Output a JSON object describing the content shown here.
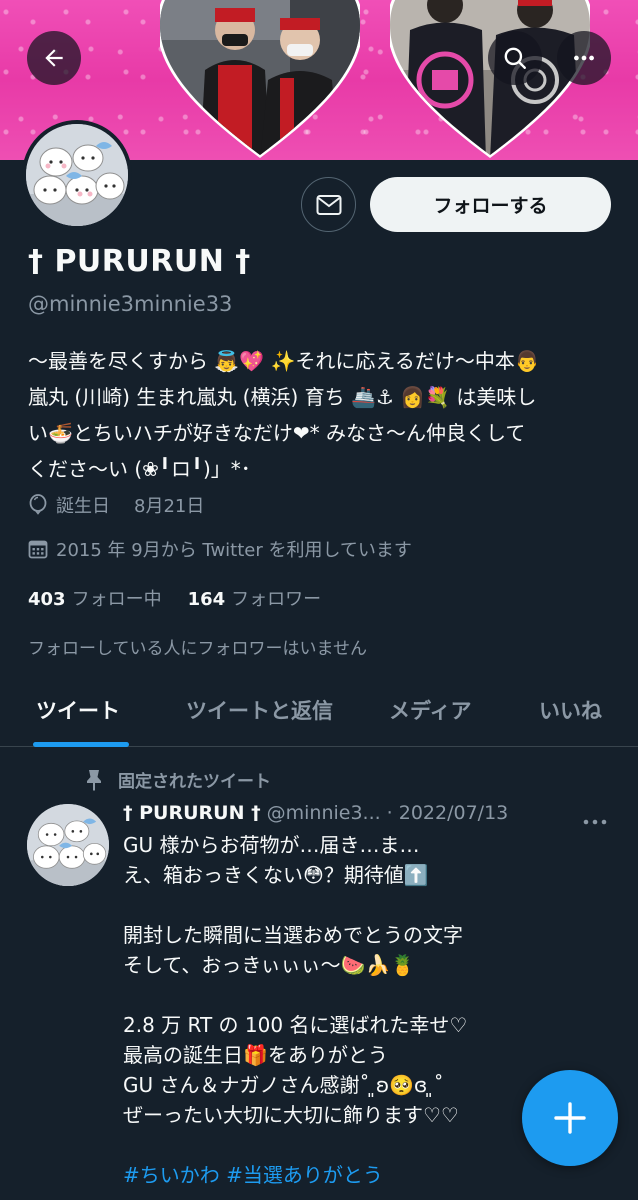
{
  "profile": {
    "display_name": "† PURURUN †",
    "handle": "@minnie3minnie33",
    "bio_lines": [
      "〜最善を尽くすから 👼💖 ✨それに応えるだけ〜中本👨",
      "嵐丸 (川崎) 生まれ嵐丸 (横浜) 育ち 🚢⚓ 👩💐 は美味し",
      "い🍜とちいハチが好きなだけ❤︎* みなさ〜ん仲良くして",
      "くださ〜い (❀╹ロ╹)」*･"
    ],
    "birthday_label": "誕生日",
    "birthday_value": "8月21日",
    "joined": "2015 年 9月から Twitter を利用しています",
    "following_count": "403",
    "following_label": "フォロー中",
    "followers_count": "164",
    "followers_label": "フォロワー",
    "no_mutuals_text": "フォローしている人にフォロワーはいません"
  },
  "actions": {
    "follow_label": "フォローする"
  },
  "tabs": [
    {
      "label": "ツイート",
      "active": true
    },
    {
      "label": "ツイートと返信",
      "active": false
    },
    {
      "label": "メディア",
      "active": false
    },
    {
      "label": "いいね",
      "active": false
    }
  ],
  "tweet": {
    "pinned_label": "固定されたツイート",
    "name": "† PURURUN †",
    "handle": "@minnie3...",
    "date": "· 2022/07/13",
    "lines": [
      "GU 様からお荷物が…届き…ま…",
      "え、箱おっきくない😳？期待値⬆️",
      "",
      "開封した瞬間に当選おめでとうの文字",
      "そして、おっきぃぃぃ〜🍉🍌🍍",
      "",
      "2.8 万 RT の 100 名に選ばれた幸せ♡",
      "最高の誕生日🎁をありがとう",
      "GU さん＆ナガノさん感謝˚ ͈ʚ🥺ɞ ͈˚",
      "ぜーったい大切に大切に飾ります♡♡",
      ""
    ],
    "hashtags": "#ちいかわ #当選ありがとう"
  },
  "icons": {
    "back": "arrow-left-icon",
    "search": "search-icon",
    "more": "more-horizontal-icon",
    "mail": "mail-icon",
    "balloon": "balloon-icon",
    "calendar": "calendar-icon",
    "pin": "pin-icon",
    "compose": "plus-icon"
  },
  "colors": {
    "background": "#15202b",
    "accent": "#1d9bf0",
    "banner_pink": "#ee4fb3",
    "muted": "#8b98a5"
  }
}
